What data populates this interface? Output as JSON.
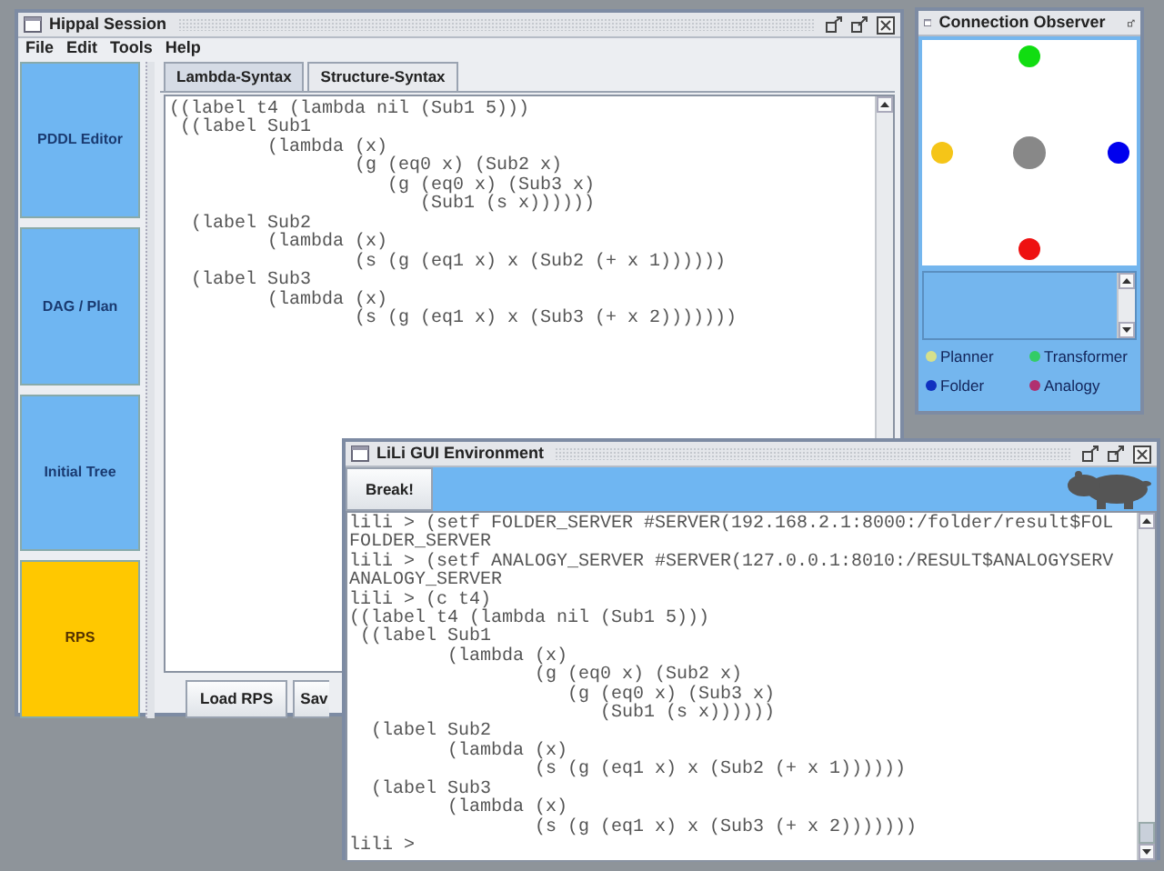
{
  "main_window": {
    "title": "Hippal Session",
    "menu": [
      "File",
      "Edit",
      "Tools",
      "Help"
    ],
    "sidebar": [
      {
        "label": "PDDL Editor",
        "selected": false
      },
      {
        "label": "DAG / Plan",
        "selected": false
      },
      {
        "label": "Initial Tree",
        "selected": false
      },
      {
        "label": "RPS",
        "selected": true
      }
    ],
    "tabs": [
      {
        "label": "Lambda-Syntax",
        "selected": true
      },
      {
        "label": "Structure-Syntax",
        "selected": false
      }
    ],
    "editor_lines": [
      "((label t4 (lambda nil (Sub1 5)))",
      " ((label Sub1",
      "         (lambda (x)",
      "                 (g (eq0 x) (Sub2 x)",
      "                    (g (eq0 x) (Sub3 x)",
      "                       (Sub1 (s x))))))",
      "  (label Sub2",
      "         (lambda (x)",
      "                 (s (g (eq1 x) x (Sub2 (+ x 1))))))",
      "  (label Sub3",
      "         (lambda (x)",
      "                 (s (g (eq1 x) x (Sub3 (+ x 2)))))))"
    ],
    "buttons": [
      "Load RPS",
      "Sav"
    ]
  },
  "observer_window": {
    "title": "Connection Observer",
    "nodes": [
      {
        "color": "#11dd11"
      },
      {
        "color": "#f5c518"
      },
      {
        "color": "#888888"
      },
      {
        "color": "#0000ee"
      },
      {
        "color": "#ee1111"
      }
    ],
    "legend": [
      {
        "label": "Planner",
        "color": "#d6e08c"
      },
      {
        "label": "Transformer",
        "color": "#33cc66"
      },
      {
        "label": "Folder",
        "color": "#1030c0"
      },
      {
        "label": "Analogy",
        "color": "#b03070"
      }
    ]
  },
  "console_window": {
    "title": "LiLi GUI Environment",
    "button": "Break!",
    "lines": [
      "lili > (setf FOLDER_SERVER #SERVER(192.168.2.1:8000:/folder/result$FOL",
      "FOLDER_SERVER",
      "lili > (setf ANALOGY_SERVER #SERVER(127.0.0.1:8010:/RESULT$ANALOGYSERV",
      "ANALOGY_SERVER",
      "lili > (c t4)",
      "((label t4 (lambda nil (Sub1 5)))",
      " ((label Sub1",
      "         (lambda (x)",
      "                 (g (eq0 x) (Sub2 x)",
      "                    (g (eq0 x) (Sub3 x)",
      "                       (Sub1 (s x))))))",
      "  (label Sub2",
      "         (lambda (x)",
      "                 (s (g (eq1 x) x (Sub2 (+ x 1))))))",
      "  (label Sub3",
      "         (lambda (x)",
      "                 (s (g (eq1 x) x (Sub3 (+ x 2)))))))",
      "lili >"
    ]
  }
}
